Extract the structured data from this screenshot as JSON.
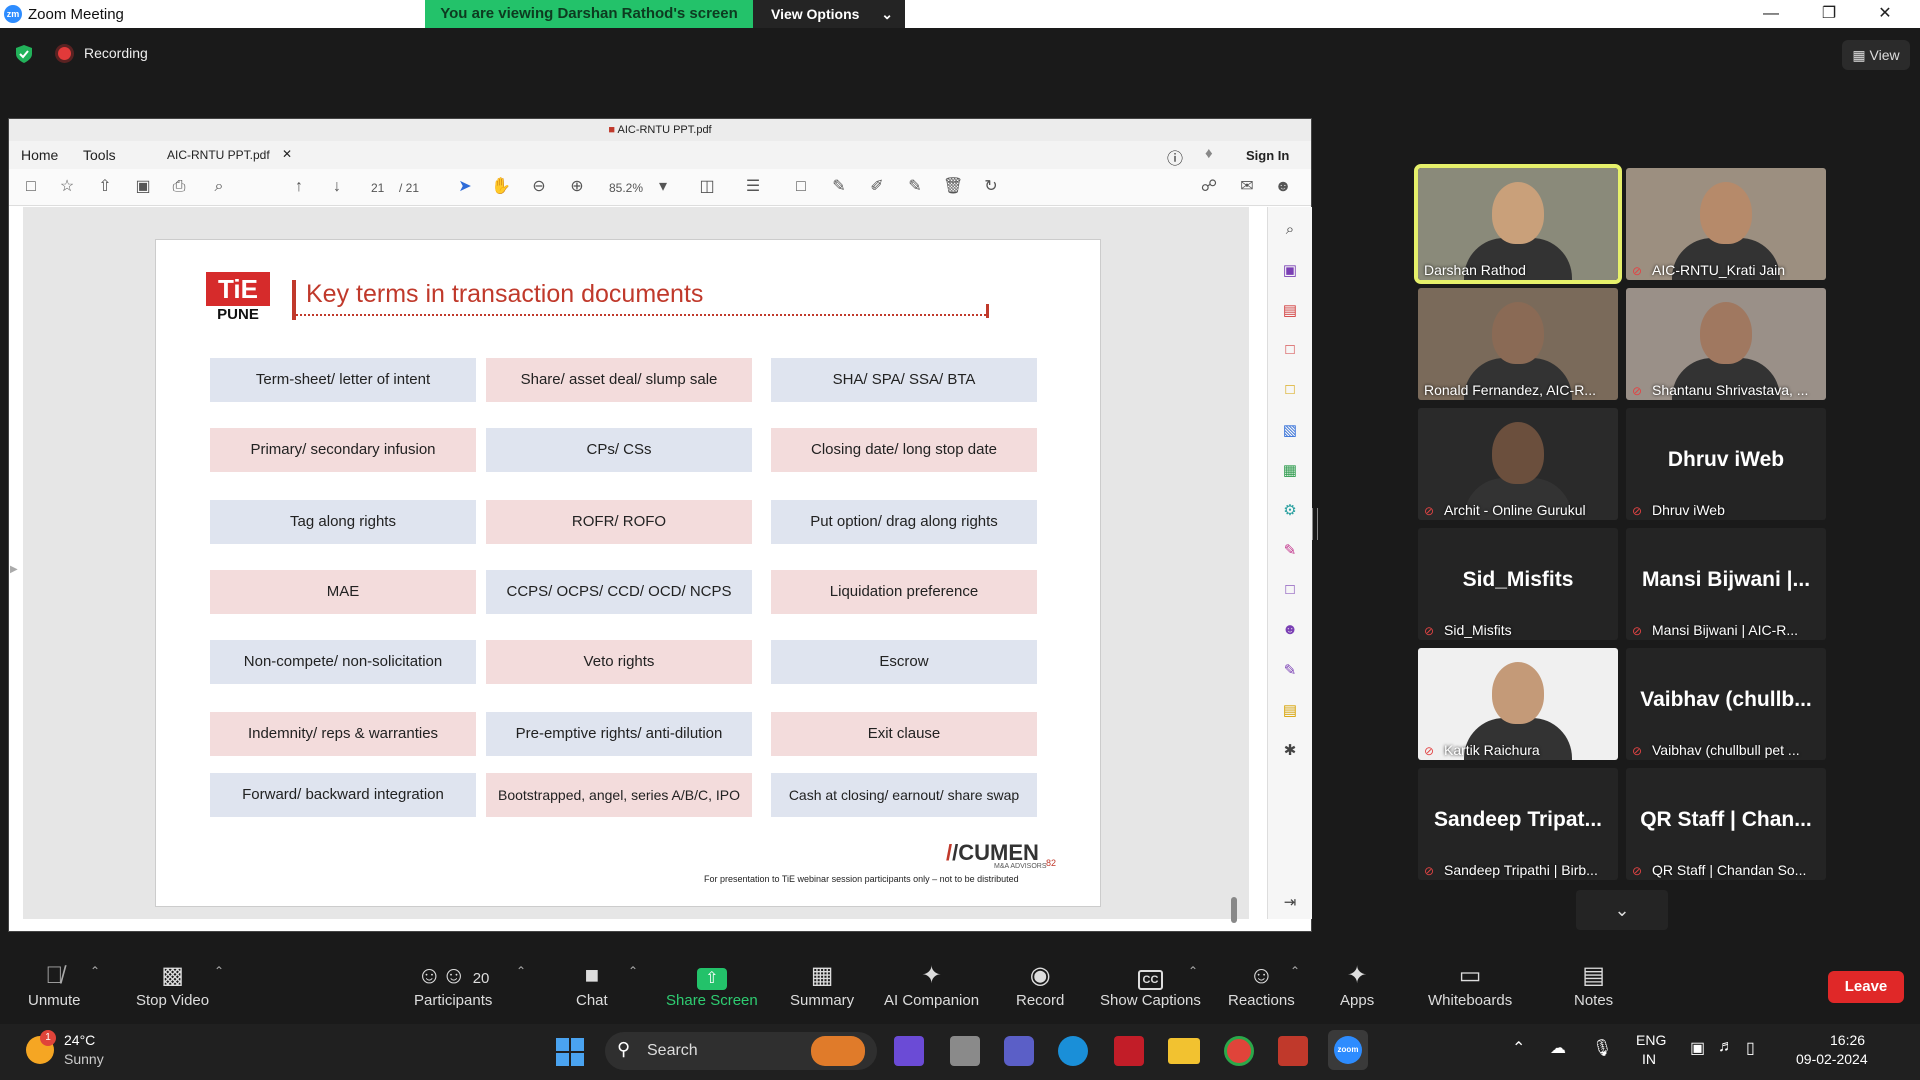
{
  "window": {
    "app_title": "Zoom Meeting"
  },
  "share_banner": {
    "viewing_text": "You are viewing Darshan Rathod's screen",
    "view_options": "View Options"
  },
  "meeting": {
    "recording_label": "Recording",
    "view_button": "View"
  },
  "pdf": {
    "file_title": "AIC-RNTU PPT.pdf",
    "tabs": [
      "Home",
      "Tools",
      "AIC-RNTU PPT.pdf"
    ],
    "sign_in": "Sign In",
    "page_current": "21",
    "page_total": "/ 21",
    "zoom": "85.2%"
  },
  "slide": {
    "logo_text": "TiE",
    "logo_sub": "PUNE",
    "title": "Key terms in transaction documents",
    "grid": [
      {
        "text": "Term-sheet/ letter of intent",
        "tone": "blue"
      },
      {
        "text": "Share/ asset deal/ slump sale",
        "tone": "pink"
      },
      {
        "text": "SHA/ SPA/ SSA/ BTA",
        "tone": "blue"
      },
      {
        "text": "Primary/ secondary infusion",
        "tone": "pink"
      },
      {
        "text": "CPs/ CSs",
        "tone": "blue"
      },
      {
        "text": "Closing date/ long stop date",
        "tone": "pink"
      },
      {
        "text": "Tag along rights",
        "tone": "blue"
      },
      {
        "text": "ROFR/ ROFO",
        "tone": "pink"
      },
      {
        "text": "Put option/ drag along rights",
        "tone": "blue"
      },
      {
        "text": "MAE",
        "tone": "pink"
      },
      {
        "text": "CCPS/ OCPS/ CCD/ OCD/ NCPS",
        "tone": "blue"
      },
      {
        "text": "Liquidation preference",
        "tone": "pink"
      },
      {
        "text": "Non-compete/ non-solicitation",
        "tone": "blue"
      },
      {
        "text": "Veto rights",
        "tone": "pink"
      },
      {
        "text": "Escrow",
        "tone": "blue"
      },
      {
        "text": "Indemnity/ reps & warranties",
        "tone": "pink"
      },
      {
        "text": "Pre-emptive rights/ anti-dilution",
        "tone": "blue"
      },
      {
        "text": "Exit clause",
        "tone": "pink"
      },
      {
        "text": "Forward/ backward integration",
        "tone": "blue"
      },
      {
        "text": "Bootstrapped, angel, series A/B/C, IPO",
        "tone": "pink"
      },
      {
        "text": "Cash at closing/ earnout/ share swap",
        "tone": "blue"
      }
    ],
    "brand": "/CUMEN",
    "brand_sub": "M&A ADVISORS",
    "page_number": "82",
    "footer": "For presentation to TiE webinar session participants only – not to be distributed"
  },
  "participants": [
    {
      "name": "Darshan Rathod",
      "video": true,
      "active": true,
      "muted": false
    },
    {
      "name": "AIC-RNTU_Krati Jain",
      "video": true,
      "active": false,
      "muted": true
    },
    {
      "name": "Ronald Fernandez, AIC-R...",
      "video": true,
      "active": false,
      "muted": false
    },
    {
      "name": "Shantanu Shrivastava, ...",
      "video": true,
      "active": false,
      "muted": true
    },
    {
      "name": "Archit - Online Gurukul",
      "video": true,
      "active": false,
      "muted": true
    },
    {
      "name": "Dhruv iWeb",
      "big": "Dhruv iWeb",
      "video": false,
      "muted": true
    },
    {
      "name": "Sid_Misfits",
      "big": "Sid_Misfits",
      "video": false,
      "muted": true
    },
    {
      "name": "Mansi Bijwani | AIC-R...",
      "big": "Mansi Bijwani |...",
      "video": false,
      "muted": true
    },
    {
      "name": "Kartik Raichura",
      "video": true,
      "active": false,
      "muted": true
    },
    {
      "name": "Vaibhav (chullbull pet ...",
      "big": "Vaibhav  (chullb...",
      "video": false,
      "muted": true
    },
    {
      "name": "Sandeep Tripathi | Birb...",
      "big": "Sandeep  Tripat...",
      "video": false,
      "muted": true
    },
    {
      "name": "QR Staff | Chandan So...",
      "big": "QR Staff  |  Chan...",
      "video": false,
      "muted": true
    }
  ],
  "toolbar": {
    "unmute": "Unmute",
    "stop_video": "Stop Video",
    "participants": "Participants",
    "participants_count": "20",
    "chat": "Chat",
    "share_screen": "Share Screen",
    "summary": "Summary",
    "ai_companion": "AI Companion",
    "record": "Record",
    "show_captions": "Show Captions",
    "reactions": "Reactions",
    "apps": "Apps",
    "whiteboards": "Whiteboards",
    "notes": "Notes",
    "leave": "Leave"
  },
  "taskbar": {
    "weather_temp": "24°C",
    "weather_desc": "Sunny",
    "weather_badge": "1",
    "search_label": "Search",
    "lang_1": "ENG",
    "lang_2": "IN",
    "time": "16:26",
    "date": "09-02-2024"
  }
}
